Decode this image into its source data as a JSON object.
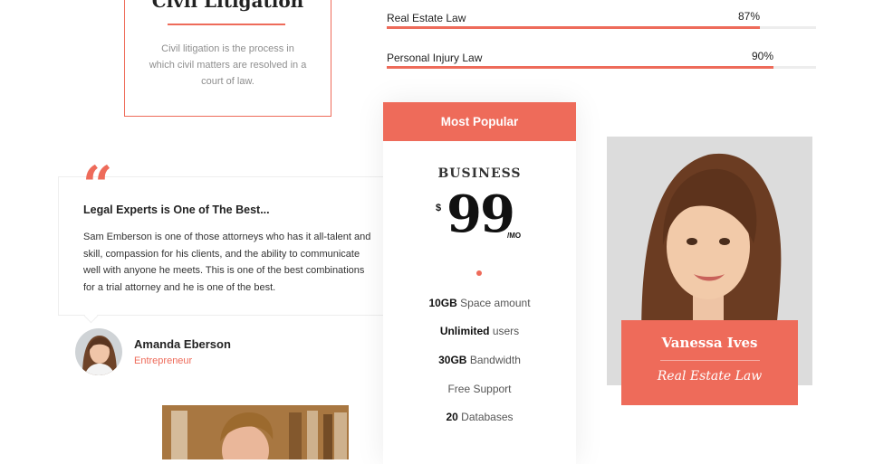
{
  "service": {
    "title": "Civil Litigation",
    "description": "Civil litigation is the process in which civil matters are resolved in a court of law."
  },
  "skills": [
    {
      "name": "Real Estate Law",
      "percent_label": "87%",
      "value": 87
    },
    {
      "name": "Personal Injury Law",
      "percent_label": "90%",
      "value": 90
    }
  ],
  "testimonial": {
    "quote_mark": "“",
    "title": "Legal Experts is One of The Best...",
    "body": "Sam Emberson is one of those attorneys who has it all-talent and skill, compassion for his clients, and the ability to communicate well with anyone he meets. This is one of the best combinations for a trial attorney and he is one of the best.",
    "author_name": "Amanda Eberson",
    "author_role": "Entrepreneur"
  },
  "pricing": {
    "badge": "Most Popular",
    "plan": "BUSINESS",
    "currency": "$",
    "amount": "99",
    "period": "/MO",
    "features": [
      {
        "value": "10GB",
        "label": "Space amount"
      },
      {
        "value": "Unlimited",
        "label": "users"
      },
      {
        "value": "30GB",
        "label": "Bandwidth"
      },
      {
        "value": "",
        "label": "Free Support"
      },
      {
        "value": "20",
        "label": "Databases"
      }
    ]
  },
  "team": {
    "name": "Vanessa Ives",
    "role": "Real Estate Law"
  },
  "colors": {
    "accent": "#ee6b5a",
    "text": "#222222",
    "muted": "#8e8e8e"
  }
}
